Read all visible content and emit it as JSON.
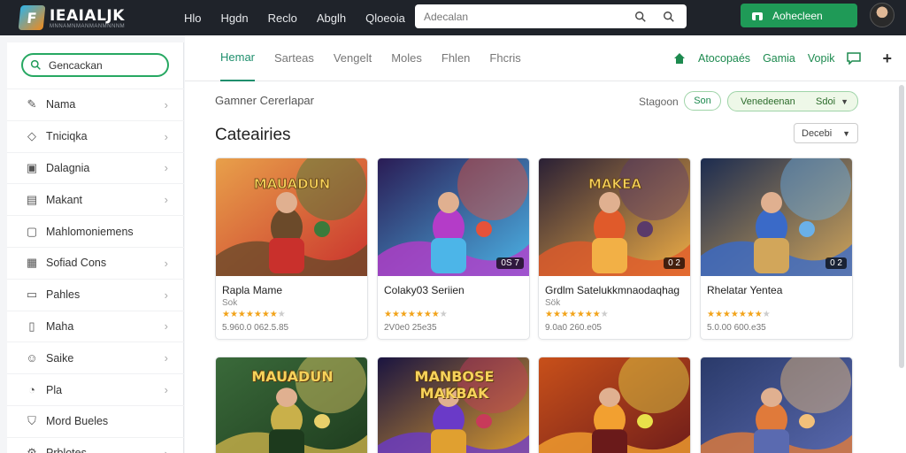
{
  "app": {
    "logo_title": "IEAIALJK",
    "logo_sub": "MNNAMNMANMANMNNNM",
    "logo_mark": "F"
  },
  "topnav": [
    "Hlo",
    "Hgdn",
    "Reclo",
    "Abglh",
    "Qloeoia"
  ],
  "search": {
    "placeholder": "Adecalan"
  },
  "cta": {
    "label": "Aohecleen"
  },
  "sidebar": {
    "search_label": "Gencackan",
    "items": [
      {
        "label": "Nama",
        "icon": "pen-icon",
        "glyph": "✎",
        "chev": true
      },
      {
        "label": "Tniciqka",
        "icon": "tag-icon",
        "glyph": "◇",
        "chev": true
      },
      {
        "label": "Dalagnia",
        "icon": "book-icon",
        "glyph": "▣",
        "chev": true
      },
      {
        "label": "Makant",
        "icon": "calendar-icon",
        "glyph": "▤",
        "chev": true
      },
      {
        "label": "Mahlomoniemens",
        "icon": "doc-icon",
        "glyph": "▢",
        "chev": false
      },
      {
        "label": "Sofiad Cons",
        "icon": "grid-icon",
        "glyph": "▦",
        "chev": true
      },
      {
        "label": "Pahles",
        "icon": "folder-icon",
        "glyph": "▭",
        "chev": true
      },
      {
        "label": "Maha",
        "icon": "file-icon",
        "glyph": "▯",
        "chev": true
      },
      {
        "label": "Saike",
        "icon": "user-icon",
        "glyph": "☺",
        "chev": true
      },
      {
        "label": "Pla",
        "icon": "clock-icon",
        "glyph": "◔",
        "chev": true
      },
      {
        "label": "Mord Bueles",
        "icon": "shield-icon",
        "glyph": "⛉",
        "chev": false
      },
      {
        "label": "Prblotes",
        "icon": "gear-icon",
        "glyph": "⚙",
        "chev": true
      }
    ]
  },
  "tabs": [
    {
      "label": "Hemar",
      "active": true
    },
    {
      "label": "Sarteas",
      "active": false
    },
    {
      "label": "Vengelt",
      "active": false
    },
    {
      "label": "Moles",
      "active": false
    },
    {
      "label": "Fhlen",
      "active": false
    },
    {
      "label": "Fhcris",
      "active": false
    }
  ],
  "tab_right": {
    "a": "Atocopaés",
    "b": "Gamia",
    "c": "Vopik"
  },
  "content": {
    "breadcrumb": "Gamner Cererlapar",
    "sort_label": "Stagoon",
    "pill": "Son",
    "select_green": "Venedeenan",
    "select_green_value": "Sdoi",
    "heading": "Cateairies",
    "select_small": "Decebi"
  },
  "cards": [
    {
      "title": "Rapla Mame",
      "sub": "Sok",
      "meta": "5.960.0 062.5.85",
      "badge": "",
      "rating": 4.5
    },
    {
      "title": "Colaky03 Seriien",
      "sub": "",
      "meta": "2V0e0 25e35",
      "badge": "0S 7",
      "rating": 4.5
    },
    {
      "title": "Grdlm Satelukkmnaodaqhag",
      "sub": "Sök",
      "meta": "9.0a0 260.e05",
      "badge": "0 2",
      "rating": 4.5
    },
    {
      "title": "Rhelatar Yentea",
      "sub": "",
      "meta": "5.0.00 600.e35",
      "badge": "0 2",
      "rating": 4.5
    }
  ],
  "cards_row2": [
    {
      "art_text": "MAUADUN"
    },
    {
      "art_text": "MANBOSE MAKBAK"
    },
    {
      "art_text": ""
    },
    {
      "art_text": ""
    }
  ],
  "colors": {
    "accent": "#1f9a57",
    "topbar": "#1f232a",
    "star": "#f2a31a"
  }
}
